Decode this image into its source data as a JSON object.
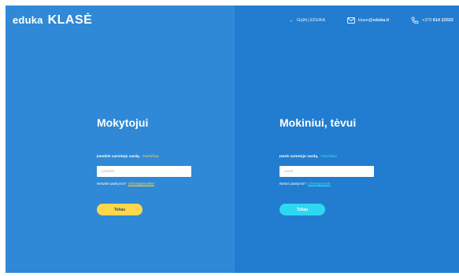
{
  "header": {
    "logo_brand": "eduka",
    "logo_product": "KLASĖ",
    "nav": {
      "back_label": "Grįžti į EDUKA",
      "email_prefix": "klase@",
      "email_domain": "eduka.lt",
      "phone_prefix": "+370",
      "phone_number": "614 22022"
    }
  },
  "teacher": {
    "title": "Mokytojui",
    "field_label": "Įveskite vartotojo vardą.",
    "field_hint_link": "Pamiršau",
    "input_placeholder": "Įveskite",
    "input_value": "",
    "register_text": "Neturite paskyros?",
    "register_link": "Užsiregistruokite",
    "submit_label": "Toliau"
  },
  "student": {
    "title": "Mokiniui, tėvui",
    "field_label": "Įvesk vartotojo vardą.",
    "field_hint_link": "Pamiršau",
    "input_placeholder": "Įvesk",
    "input_value": "",
    "register_text": "Neturi paskyros?",
    "register_link": "Užsiregistruok",
    "submit_label": "Toliau"
  },
  "colors": {
    "left_panel": "#2f89d6",
    "right_panel": "#227dd0",
    "accent_yellow": "#ffd84a",
    "accent_cyan": "#2fd8f2"
  },
  "icons": {
    "back": "arrow-left-icon",
    "email": "envelope-icon",
    "phone": "phone-icon"
  }
}
